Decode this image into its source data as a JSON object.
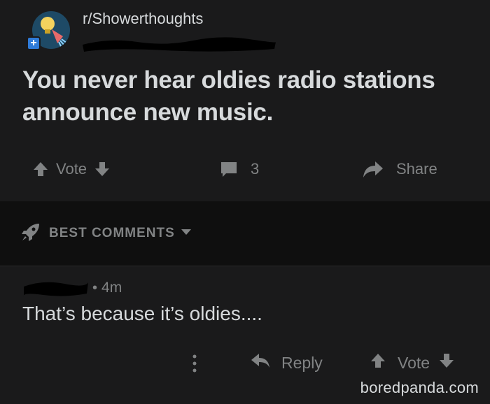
{
  "post": {
    "subreddit": "r/Showerthoughts",
    "title": "You never hear oldies radio stations announce new music.",
    "vote_label": "Vote",
    "comment_count": "3",
    "share_label": "Share"
  },
  "sort": {
    "label": "BEST COMMENTS"
  },
  "comment": {
    "age": "4m",
    "separator": "•",
    "body": "That’s because it’s oldies....",
    "reply_label": "Reply",
    "vote_label": "Vote"
  },
  "watermark": "boredpanda.com",
  "colors": {
    "background": "#1a1a1b",
    "sortbar": "#0f0f0f",
    "text": "#d7dadc",
    "muted": "#818384",
    "join_badge": "#2f7bd8"
  },
  "icons": [
    "upvote-icon",
    "downvote-icon",
    "comment-icon",
    "share-icon",
    "rocket-icon",
    "chevron-down-icon",
    "more-vertical-icon",
    "reply-icon"
  ]
}
